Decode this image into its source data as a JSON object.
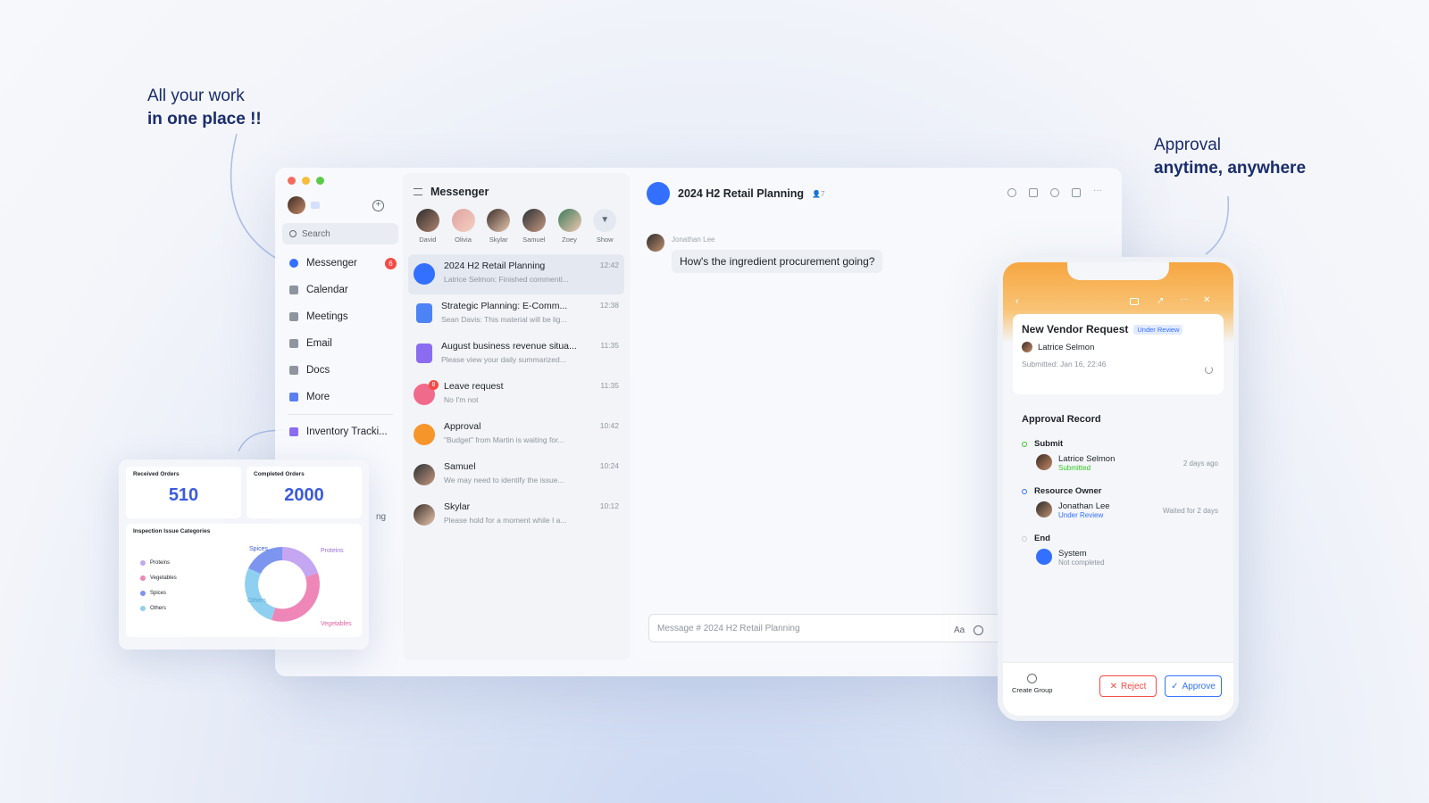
{
  "taglines": {
    "left_line1": "All your work",
    "left_line2": "in one place !!",
    "right_line1": "Approval",
    "right_line2": "anytime, anywhere"
  },
  "colors": {
    "accent": "#3370ff",
    "brand_navy": "#1a2d6b",
    "danger": "#f54a45",
    "success": "#34c724",
    "approval_orange": "#f6a640"
  },
  "sidebar": {
    "search_placeholder": "Search",
    "items": [
      {
        "label": "Messenger",
        "icon": "messenger-icon",
        "badge": "6"
      },
      {
        "label": "Calendar",
        "icon": "calendar-icon"
      },
      {
        "label": "Meetings",
        "icon": "video-icon"
      },
      {
        "label": "Email",
        "icon": "mail-icon"
      },
      {
        "label": "Docs",
        "icon": "doc-icon"
      },
      {
        "label": "More",
        "icon": "grid-icon"
      }
    ],
    "pinned": {
      "label": "Inventory Tracki...",
      "icon": "app-icon"
    },
    "partial_label": "ng"
  },
  "messenger": {
    "title": "Messenger",
    "contacts": [
      "David",
      "Olivia",
      "Skylar",
      "Samuel",
      "Zoey",
      "Show"
    ],
    "conversations": [
      {
        "title": "2024 H2 Retail Planning",
        "preview": "Latrice Selmon: Finished commenti...",
        "time": "12:42"
      },
      {
        "title": "Strategic Planning: E-Comm...",
        "preview": "Sean Davis: This material will be lig...",
        "time": "12:38"
      },
      {
        "title": "August business revenue situa...",
        "preview": "Please view your daily summarized...",
        "time": "11:35"
      },
      {
        "title": "Leave request",
        "preview": "No I'm not",
        "time": "11:35",
        "badge": "8"
      },
      {
        "title": "Approval",
        "preview": "\"Budget\" from Martin is waiting for...",
        "time": "10:42"
      },
      {
        "title": "Samuel",
        "preview": "We may need to identify the issue...",
        "time": "10:24"
      },
      {
        "title": "Skylar",
        "preview": "Please hold for a moment while I a...",
        "time": "10:12"
      }
    ]
  },
  "chat": {
    "title": "2024 H2 Retail Planning",
    "member_count": "7",
    "sender": "Jonathan Lee",
    "message": "How's the ingredient procurement going?",
    "input_placeholder": "Message # 2024 H2 Retail Planning",
    "font_tool": "Aa"
  },
  "dashboard": {
    "received_label": "Received Orders",
    "received_value": "510",
    "completed_label": "Completed Orders",
    "completed_value": "2000",
    "pie_title": "Inspection Issue Categories",
    "legend": [
      "Proteins",
      "Vegetables",
      "Spices",
      "Others"
    ],
    "pie_labels": {
      "spices": "Spices",
      "proteins": "Proteins",
      "others": "Others",
      "vegetables": "Vegetables"
    }
  },
  "phone": {
    "request_title": "New Vendor Request",
    "status_badge": "Under Review",
    "requester": "Latrice Selmon",
    "submitted": "Submitted: Jan 16, 22:46",
    "record_title": "Approval Record",
    "steps": [
      {
        "name": "Submit",
        "person": "Latrice Selmon",
        "status": "Submitted",
        "right": "2 days ago"
      },
      {
        "name": "Resource Owner",
        "person": "Jonathan Lee",
        "status": "Under Review",
        "right": "Waited for 2 days"
      },
      {
        "name": "End",
        "person": "System",
        "status": "Not completed",
        "right": ""
      }
    ],
    "create_group": "Create Group",
    "reject": "Reject",
    "approve": "Approve"
  }
}
